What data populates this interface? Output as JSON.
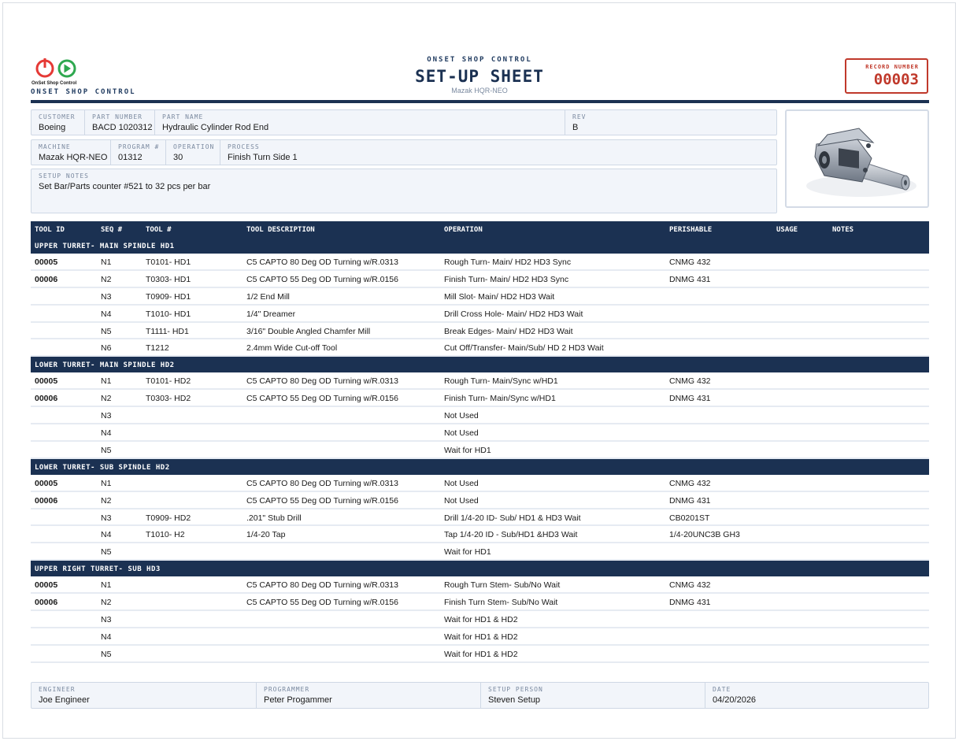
{
  "brand": {
    "logo_text": "OnSet Shop Control",
    "left_name": "ONSET SHOP CONTROL",
    "center_name": "ONSET SHOP CONTROL",
    "title": "SET-UP SHEET",
    "machine_subtitle": "Mazak HQR-NEO",
    "colors": {
      "primary": "#1b3152",
      "record": "#c0392b",
      "logo_red": "#e53935",
      "logo_green": "#2ea84f"
    }
  },
  "record": {
    "label": "RECORD NUMBER",
    "number": "00003"
  },
  "info": {
    "customer_label": "CUSTOMER",
    "customer": "Boeing",
    "part_number_label": "PART NUMBER",
    "part_number": "BACD 1020312",
    "part_name_label": "PART NAME",
    "part_name": "Hydraulic Cylinder Rod End",
    "rev_label": "REV",
    "rev": "B",
    "machine_label": "MACHINE",
    "machine": "Mazak HQR-NEO",
    "program_label": "PROGRAM #",
    "program": "01312",
    "operation_label": "OPERATION",
    "operation": "30",
    "process_label": "PROCESS",
    "process": "Finish Turn Side 1",
    "setup_notes_label": "SETUP NOTES",
    "setup_notes": "Set Bar/Parts counter #521 to 32 pcs per bar"
  },
  "table": {
    "headers": [
      "TOOL ID",
      "SEQ #",
      "TOOL #",
      "TOOL DESCRIPTION",
      "OPERATION",
      "PERISHABLE",
      "USAGE",
      "NOTES"
    ],
    "sections": [
      {
        "title": "UPPER TURRET- MAIN SPINDLE HD1",
        "rows": [
          [
            "00005",
            "N1",
            "T0101- HD1",
            "C5 CAPTO 80 Deg OD Turning w/R.0313",
            "Rough Turn- Main/ HD2 HD3 Sync",
            "CNMG 432",
            "",
            ""
          ],
          [
            "00006",
            "N2",
            "T0303- HD1",
            "C5 CAPTO 55 Deg OD Turning w/R.0156",
            "Finish Turn- Main/ HD2 HD3 Sync",
            "DNMG 431",
            "",
            ""
          ],
          [
            "",
            "N3",
            "T0909- HD1",
            "1/2 End Mill",
            "Mill Slot- Main/ HD2 HD3 Wait",
            "",
            "",
            ""
          ],
          [
            "",
            "N4",
            "T1010- HD1",
            "1/4\" Dreamer",
            "Drill Cross Hole- Main/ HD2 HD3 Wait",
            "",
            "",
            ""
          ],
          [
            "",
            "N5",
            "T1111- HD1",
            "3/16\" Double Angled Chamfer Mill",
            "Break Edges- Main/ HD2 HD3 Wait",
            "",
            "",
            ""
          ],
          [
            "",
            "N6",
            "T1212",
            "2.4mm Wide Cut-off Tool",
            "Cut Off/Transfer- Main/Sub/ HD 2 HD3 Wait",
            "",
            "",
            ""
          ]
        ]
      },
      {
        "title": "LOWER TURRET- MAIN SPINDLE HD2",
        "rows": [
          [
            "00005",
            "N1",
            "T0101- HD2",
            "C5 CAPTO 80 Deg OD Turning w/R.0313",
            "Rough Turn- Main/Sync w/HD1",
            "CNMG 432",
            "",
            ""
          ],
          [
            "00006",
            "N2",
            "T0303- HD2",
            "C5 CAPTO 55 Deg OD Turning w/R.0156",
            "Finish Turn- Main/Sync w/HD1",
            "DNMG 431",
            "",
            ""
          ],
          [
            "",
            "N3",
            "",
            "",
            "Not Used",
            "",
            "",
            ""
          ],
          [
            "",
            "N4",
            "",
            "",
            "Not Used",
            "",
            "",
            ""
          ],
          [
            "",
            "N5",
            "",
            "",
            "Wait for HD1",
            "",
            "",
            ""
          ]
        ]
      },
      {
        "title": "LOWER TURRET- SUB SPINDLE HD2",
        "rows": [
          [
            "00005",
            "N1",
            "",
            "C5 CAPTO 80 Deg OD Turning w/R.0313",
            "Not Used",
            "CNMG 432",
            "",
            ""
          ],
          [
            "00006",
            "N2",
            "",
            "C5 CAPTO 55 Deg OD Turning w/R.0156",
            "Not Used",
            "DNMG 431",
            "",
            ""
          ],
          [
            "",
            "N3",
            "T0909- HD2",
            ".201\" Stub Drill",
            "Drill 1/4-20 ID- Sub/ HD1 & HD3 Wait",
            "CB0201ST",
            "",
            ""
          ],
          [
            "",
            "N4",
            "T1010- H2",
            "1/4-20 Tap",
            "Tap 1/4-20 ID - Sub/HD1 &HD3 Wait",
            "1/4-20UNC3B GH3",
            "",
            ""
          ],
          [
            "",
            "N5",
            "",
            "",
            "Wait for HD1",
            "",
            "",
            ""
          ]
        ]
      },
      {
        "title": "UPPER RIGHT TURRET- SUB HD3",
        "rows": [
          [
            "00005",
            "N1",
            "",
            "C5 CAPTO 80 Deg OD Turning w/R.0313",
            "Rough Turn Stem- Sub/No Wait",
            "CNMG 432",
            "",
            ""
          ],
          [
            "00006",
            "N2",
            "",
            "C5 CAPTO 55 Deg OD Turning w/R.0156",
            "Finish Turn Stem- Sub/No Wait",
            "DNMG 431",
            "",
            ""
          ],
          [
            "",
            "N3",
            "",
            "",
            "Wait for HD1 & HD2",
            "",
            "",
            ""
          ],
          [
            "",
            "N4",
            "",
            "",
            "Wait for HD1 & HD2",
            "",
            "",
            ""
          ],
          [
            "",
            "N5",
            "",
            "",
            "Wait for HD1 & HD2",
            "",
            "",
            ""
          ]
        ]
      }
    ]
  },
  "footer": {
    "engineer_label": "ENGINEER",
    "engineer": "Joe Engineer",
    "programmer_label": "PROGRAMMER",
    "programmer": "Peter Progammer",
    "setup_person_label": "SETUP PERSON",
    "setup_person": "Steven Setup",
    "date_label": "DATE",
    "date": "04/20/2026"
  }
}
